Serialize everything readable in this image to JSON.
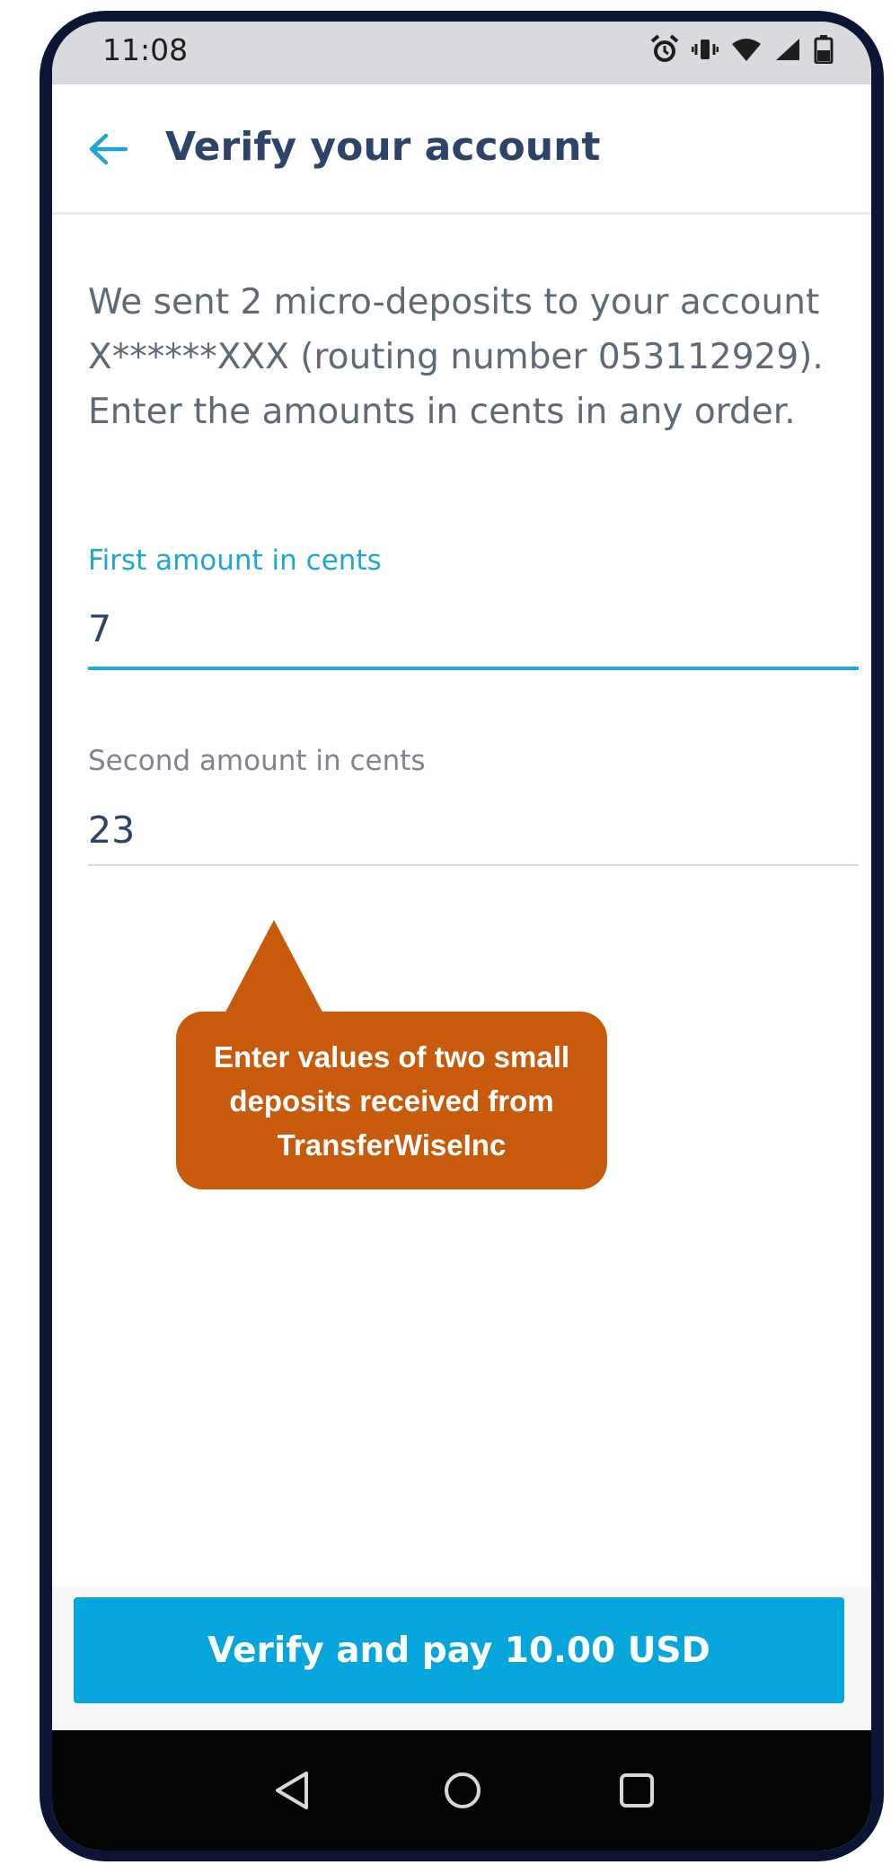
{
  "status_bar": {
    "time": "11:08",
    "icons": [
      "alarm-icon",
      "vibrate-icon",
      "wifi-icon",
      "signal-icon",
      "battery-icon"
    ]
  },
  "app_bar": {
    "back_icon": "arrow-left-icon",
    "title": "Verify your account"
  },
  "description": "We sent 2 micro-deposits to your account X******XXX (routing number 053112929). Enter the amounts in cents in any order.",
  "fields": [
    {
      "label": "First amount in cents",
      "value": "7",
      "focused": true
    },
    {
      "label": "Second amount in cents",
      "value": "23",
      "focused": false
    }
  ],
  "callout": {
    "text": "Enter values of two small deposits received from TransferWiseInc",
    "color": "#c85a0c"
  },
  "verify_button": {
    "label": "Verify and pay 10.00 USD",
    "color": "#06a6dc"
  },
  "nav_bar": {
    "icons": [
      "nav-back-icon",
      "nav-home-icon",
      "nav-recent-apps-icon"
    ]
  },
  "colors": {
    "title": "#2e4369",
    "accent": "#1ea6d4",
    "body_text": "#5f6a77"
  }
}
